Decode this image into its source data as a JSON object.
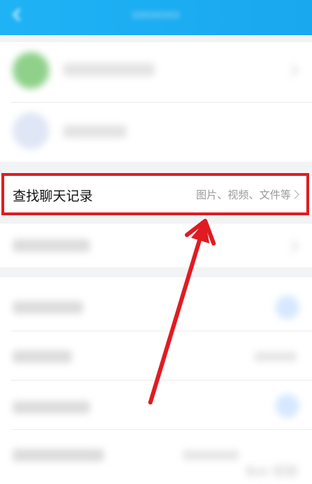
{
  "find_chat_row": {
    "label": "查找聊天记录",
    "hint": "图片、视频、文件等"
  },
  "colors": {
    "topbar": "#1fb3f5",
    "highlight": "#e11b22",
    "arrow": "#e11b22"
  },
  "icons": {
    "back": "back-arrow-icon",
    "chevron": "chevron-right-icon"
  }
}
